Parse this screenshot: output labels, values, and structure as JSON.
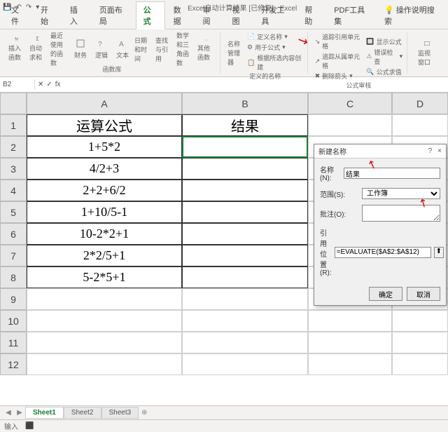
{
  "app_title": "Excel自动计算结果 [已修复] - Excel",
  "qat": {
    "save": "💾",
    "undo": "↶",
    "redo": "↷",
    "more": "▾"
  },
  "tabs": [
    "文件",
    "开始",
    "插入",
    "页面布局",
    "公式",
    "数据",
    "审阅",
    "视图",
    "开发工具",
    "帮助",
    "PDF工具集"
  ],
  "tell_me": "操作说明搜索",
  "active_tab": "公式",
  "ribbon": {
    "g1_items": [
      "插入函数",
      "自动求和",
      "最近使用的函数",
      "财务",
      "逻辑",
      "文本",
      "日期和时间",
      "查找与引用",
      "数学和三角函数",
      "其他函数"
    ],
    "g1_label": "函数库",
    "g2_name_mgr": "名称管理器",
    "g2_define": "定义名称",
    "g2_usein": "用于公式",
    "g2_create": "根据所选内容创建",
    "g2_label": "定义的名称",
    "g3_a": "追踪引用单元格",
    "g3_b": "追踪从属单元格",
    "g3_c": "删除箭头",
    "g3_d": "显示公式",
    "g3_e": "错误检查",
    "g3_f": "公式求值",
    "g3_label": "公式审核",
    "g4": "监视窗口"
  },
  "namebox": "B2",
  "fx_label": "fx",
  "cols": [
    "A",
    "B",
    "C",
    "D"
  ],
  "rows": [
    "1",
    "2",
    "3",
    "4",
    "5",
    "6",
    "7",
    "8",
    "9",
    "10",
    "11",
    "12"
  ],
  "table": {
    "header_a": "运算公式",
    "header_b": "结果",
    "a": [
      "1+5*2",
      "4/2+3",
      "2+2+6/2",
      "1+10/5-1",
      "10-2*2+1",
      "2*2/5+1",
      "5-2*5+1"
    ]
  },
  "dialog": {
    "title": "新建名称",
    "help": "?",
    "close": "×",
    "name_lbl": "名称(N):",
    "name_val": "结果",
    "scope_lbl": "范围(S):",
    "scope_val": "工作簿",
    "comment_lbl": "批注(O):",
    "ref_lbl": "引用位置(R):",
    "ref_val": "=EVALUATE($A$2:$A$12)",
    "ok": "确定",
    "cancel": "取消"
  },
  "sheets": [
    "Sheet1",
    "Sheet2",
    "Sheet3"
  ],
  "status": {
    "mode": "输入",
    "rec": "⬛"
  }
}
